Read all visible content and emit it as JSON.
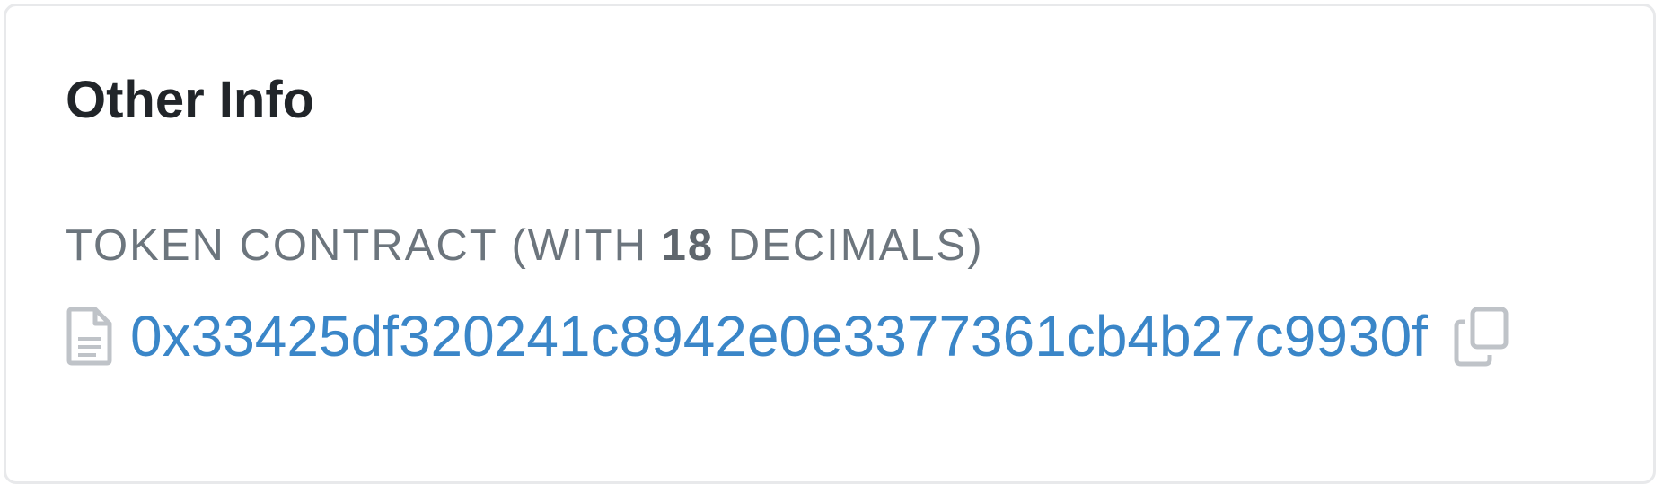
{
  "card": {
    "title": "Other Info",
    "token_contract": {
      "label_prefix": "TOKEN CONTRACT (WITH ",
      "decimals": "18",
      "label_suffix": " DECIMALS)",
      "address": "0x33425df320241c8942e0e3377361cb4b27c9930f",
      "contract_icon": "file-text-icon",
      "copy_icon": "copy-icon"
    }
  },
  "colors": {
    "title": "#212529",
    "label": "#6c757d",
    "link": "#3a86c8",
    "icon": "#bfc3c8",
    "border": "#e8e9eb"
  }
}
